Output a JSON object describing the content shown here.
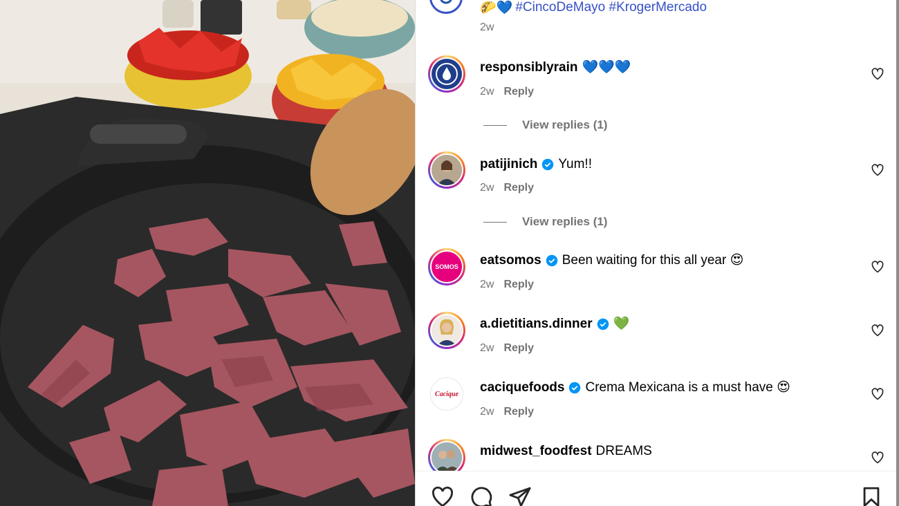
{
  "post": {
    "caption_emoji": "🌮💙",
    "hashtags": "#CincoDeMayo #KrogerMercado",
    "caption_time": "2w"
  },
  "comments": [
    {
      "username": "responsiblyrain",
      "verified": false,
      "text": "💙💙💙",
      "time": "2w",
      "reply_label": "Reply",
      "view_replies": "View replies (1)",
      "avatar_icon": "water-drop-logo"
    },
    {
      "username": "patijinich",
      "verified": true,
      "text": "Yum!!",
      "time": "2w",
      "reply_label": "Reply",
      "view_replies": "View replies (1)",
      "avatar_icon": "profile-photo"
    },
    {
      "username": "eatsomos",
      "verified": true,
      "text": "Been waiting for this all year 😍",
      "time": "2w",
      "reply_label": "Reply",
      "avatar_icon": "somos-logo",
      "avatar_text": "SOMOS"
    },
    {
      "username": "a.dietitians.dinner",
      "verified": true,
      "text": "💚",
      "time": "2w",
      "reply_label": "Reply",
      "avatar_icon": "profile-photo"
    },
    {
      "username": "caciquefoods",
      "verified": true,
      "text": "Crema Mexicana is a must have 😍",
      "time": "2w",
      "reply_label": "Reply",
      "avatar_icon": "cacique-logo",
      "avatar_text": "Cacique"
    },
    {
      "username": "midwest_foodfest",
      "verified": false,
      "text": "DREAMS",
      "avatar_icon": "profile-photo"
    }
  ],
  "actions": [
    "like-icon",
    "comment-icon",
    "share-icon",
    "save-icon"
  ],
  "colors": {
    "link": "#3550c8",
    "muted": "#737373",
    "verified": "#0095f6",
    "somos": "#e6007e"
  }
}
